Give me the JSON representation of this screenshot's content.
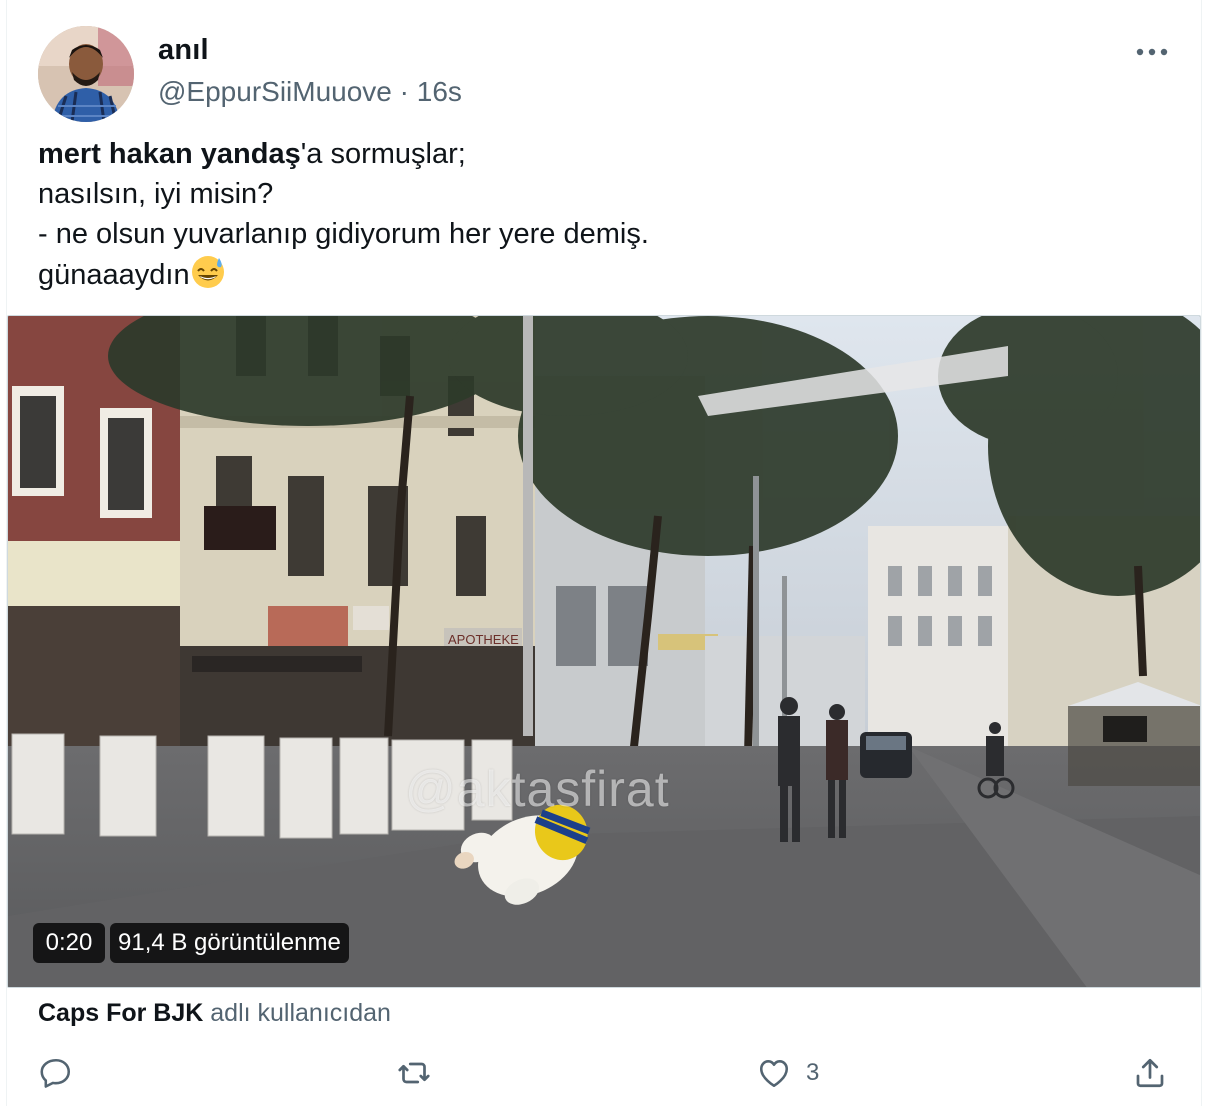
{
  "tweet": {
    "author_name": "anıl",
    "handle": "@EppurSiiMuuove",
    "separator": " · ",
    "time_ago": "16s",
    "text_bold": "mert hakan yandaş",
    "text_rest": "'a sormuşlar;\nnasılsın, iyi misin?\n- ne olsun yuvarlanıp gidiyorum her yere demiş.\ngünaaaydın",
    "emoji": "sweat-smile-emoji"
  },
  "video": {
    "duration": "0:20",
    "views": "91,4 B görüntülenme",
    "watermark": "@aktasfirat",
    "sign_text": "APOTHEKE"
  },
  "source": {
    "account": "Caps For BJK",
    "suffix": " adlı kullanıcıdan"
  },
  "actions": {
    "like_count": "3"
  },
  "icons": [
    "more-icon",
    "reply-icon",
    "retweet-icon",
    "like-icon",
    "share-icon"
  ],
  "colors": {
    "text_primary": "#0f1419",
    "text_secondary": "#536471",
    "border": "#cfd9de"
  }
}
